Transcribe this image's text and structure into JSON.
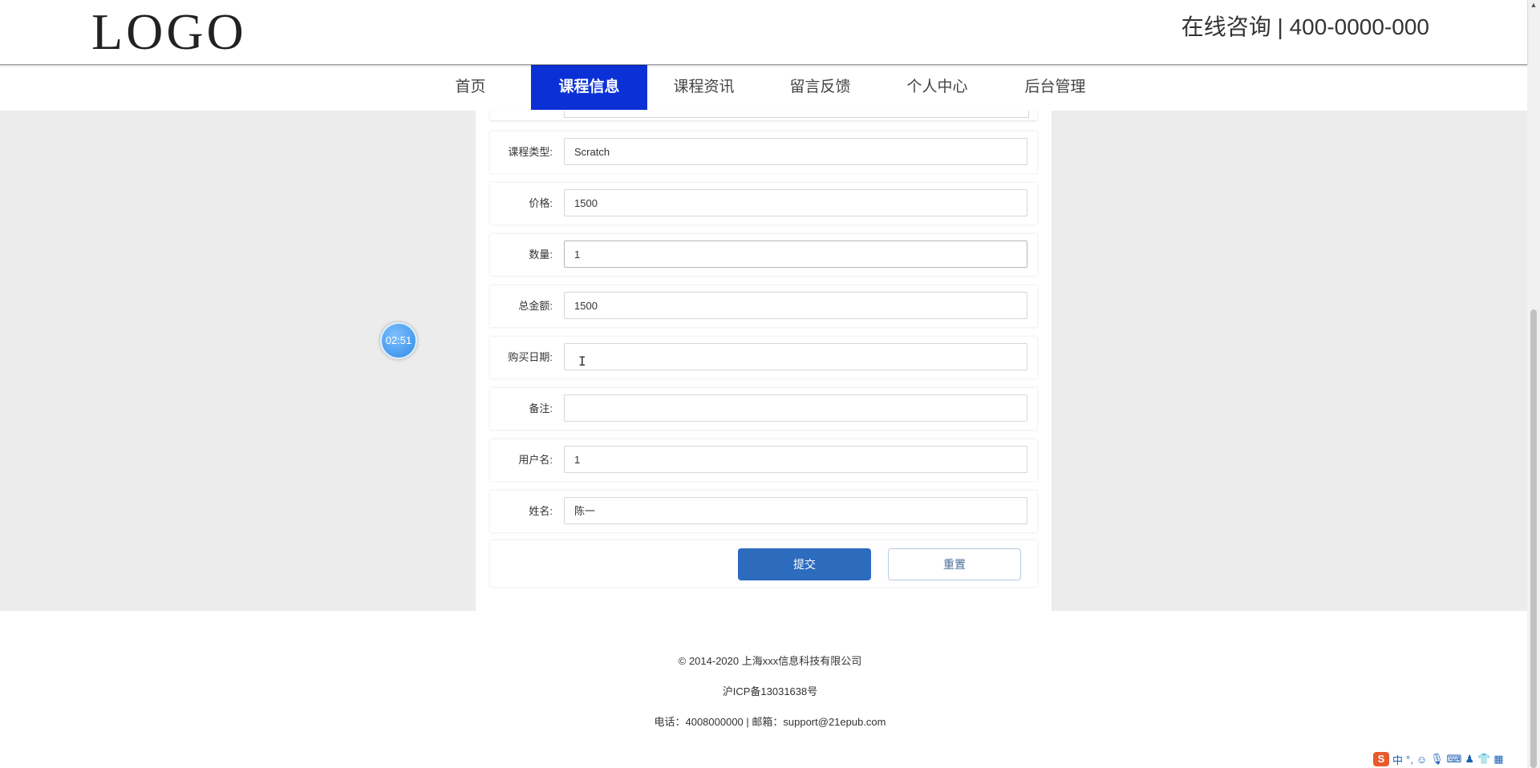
{
  "header": {
    "logo": "LOGO",
    "contact": "在线咨询 | 400-0000-000"
  },
  "nav": {
    "items": [
      {
        "label": "首页"
      },
      {
        "label": "课程信息"
      },
      {
        "label": "课程资讯"
      },
      {
        "label": "留言反馈"
      },
      {
        "label": "个人中心"
      },
      {
        "label": "后台管理"
      }
    ],
    "active": "课程信息"
  },
  "form": {
    "fields": [
      {
        "label": "课程类型:",
        "value": "Scratch"
      },
      {
        "label": "价格:",
        "value": "1500"
      },
      {
        "label": "数量:",
        "value": "1"
      },
      {
        "label": "总金额:",
        "value": "1500"
      },
      {
        "label": "购买日期:",
        "value": ""
      },
      {
        "label": "备注:",
        "value": ""
      },
      {
        "label": "用户名:",
        "value": "1"
      },
      {
        "label": "姓名:",
        "value": "陈一"
      }
    ],
    "submit_label": "提交",
    "reset_label": "重置"
  },
  "timer": "02:51",
  "footer": {
    "copyright": "© 2014-2020 上海xxx信息科技有限公司",
    "icp": "沪ICP备13031638号",
    "contact": "电话：4008000000 | 邮箱：support@21epub.com"
  },
  "taskbar": {
    "ime_label": "中"
  },
  "colors": {
    "nav_active": "#0b31d6",
    "submit": "#2d6bbd",
    "band": "#ececec"
  }
}
